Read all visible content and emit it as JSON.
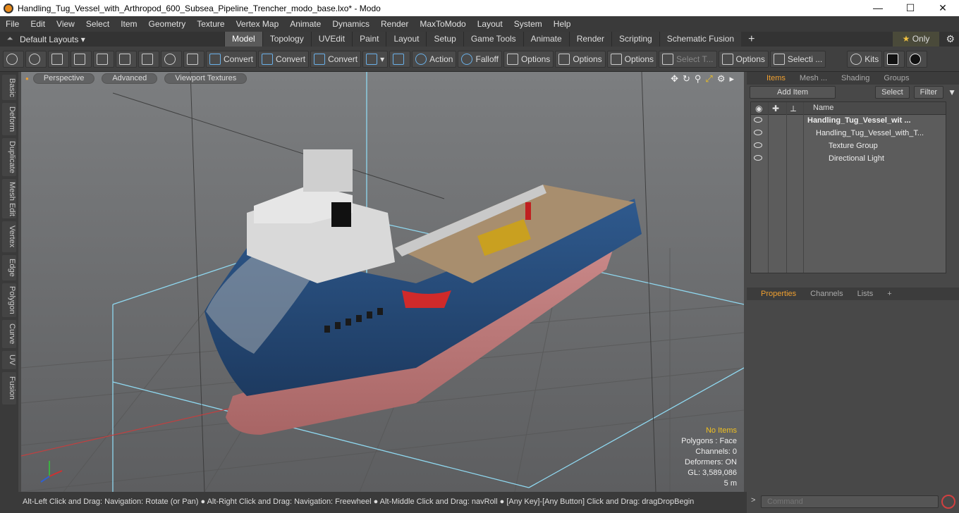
{
  "window": {
    "title": "Handling_Tug_Vessel_with_Arthropod_600_Subsea_Pipeline_Trencher_modo_base.lxo* - Modo",
    "minimize": "—",
    "maximize": "☐",
    "close": "✕"
  },
  "menu": [
    "File",
    "Edit",
    "View",
    "Select",
    "Item",
    "Geometry",
    "Texture",
    "Vertex Map",
    "Animate",
    "Dynamics",
    "Render",
    "MaxToModo",
    "Layout",
    "System",
    "Help"
  ],
  "layouts": {
    "label": "Default Layouts ▾",
    "tabs": [
      "Model",
      "Topology",
      "UVEdit",
      "Paint",
      "Layout",
      "Setup",
      "Game Tools",
      "Animate",
      "Render",
      "Scripting",
      "Schematic Fusion"
    ],
    "active": "Model",
    "plus": "+",
    "only": "Only"
  },
  "toolbar": {
    "convert1": "Convert",
    "convert2": "Convert",
    "convert3": "Convert",
    "action": "Action",
    "falloff": "Falloff",
    "options1": "Options",
    "options2": "Options",
    "options3": "Options",
    "select_t": "Select T...",
    "options4": "Options",
    "selecti": "Selecti ...",
    "kits": "Kits"
  },
  "left_tabs": [
    "Basic",
    "Deform",
    "Duplicate",
    "Mesh Edit",
    "Vertex",
    "Edge",
    "Polygon",
    "Curve",
    "UV",
    "Fusion"
  ],
  "viewport": {
    "perspective": "Perspective",
    "advanced": "Advanced",
    "textures": "Viewport Textures",
    "stats": {
      "no_items": "No Items",
      "polygons": "Polygons : Face",
      "channels": "Channels: 0",
      "deformers": "Deformers: ON",
      "gl": "GL: 3,589,086",
      "scale": "5 m"
    }
  },
  "statusbar": "Alt-Left Click and Drag: Navigation: Rotate (or Pan) ● Alt-Right Click and Drag: Navigation: Freewheel ● Alt-Middle Click and Drag: navRoll ● [Any Key]-[Any Button] Click and Drag: dragDropBegin",
  "items_panel": {
    "tabs": [
      "Items",
      "Mesh ...",
      "Shading",
      "Groups"
    ],
    "active_tab": "Items",
    "add_item": "Add Item",
    "select": "Select",
    "filter": "Filter",
    "name_header": "Name",
    "rows": [
      {
        "label": "Handling_Tug_Vessel_wit ..."
      },
      {
        "label": "Handling_Tug_Vessel_with_T..."
      },
      {
        "label": "Texture Group"
      },
      {
        "label": "Directional Light"
      }
    ]
  },
  "properties_panel": {
    "tabs": [
      "Properties",
      "Channels",
      "Lists"
    ],
    "active_tab": "Properties",
    "plus": "+"
  },
  "command": {
    "placeholder": "Command"
  }
}
